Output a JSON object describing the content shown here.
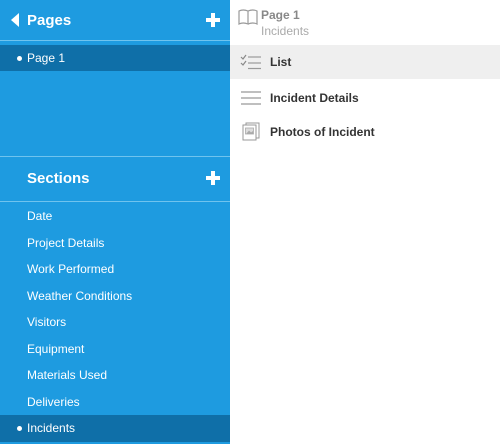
{
  "sidebar": {
    "pages_header": "Pages",
    "pages": [
      {
        "label": "Page 1",
        "active": true
      }
    ],
    "sections_header": "Sections",
    "sections": [
      {
        "label": "Date"
      },
      {
        "label": "Project Details"
      },
      {
        "label": "Work Performed"
      },
      {
        "label": "Weather Conditions"
      },
      {
        "label": "Visitors"
      },
      {
        "label": "Equipment"
      },
      {
        "label": "Materials Used"
      },
      {
        "label": "Deliveries"
      },
      {
        "label": "Incidents",
        "active": true
      }
    ]
  },
  "content": {
    "breadcrumb": {
      "page": "Page 1",
      "section": "Incidents"
    },
    "items": [
      {
        "label": "List",
        "icon": "checklist-icon",
        "selected": true
      },
      {
        "label": "Incident Details",
        "icon": "lines-icon"
      },
      {
        "label": "Photos of Incident",
        "icon": "photos-icon"
      }
    ]
  },
  "colors": {
    "sidebar": "#1e9be0",
    "sidebar_active": "#0f6fa8",
    "selected_row": "#efefef"
  }
}
